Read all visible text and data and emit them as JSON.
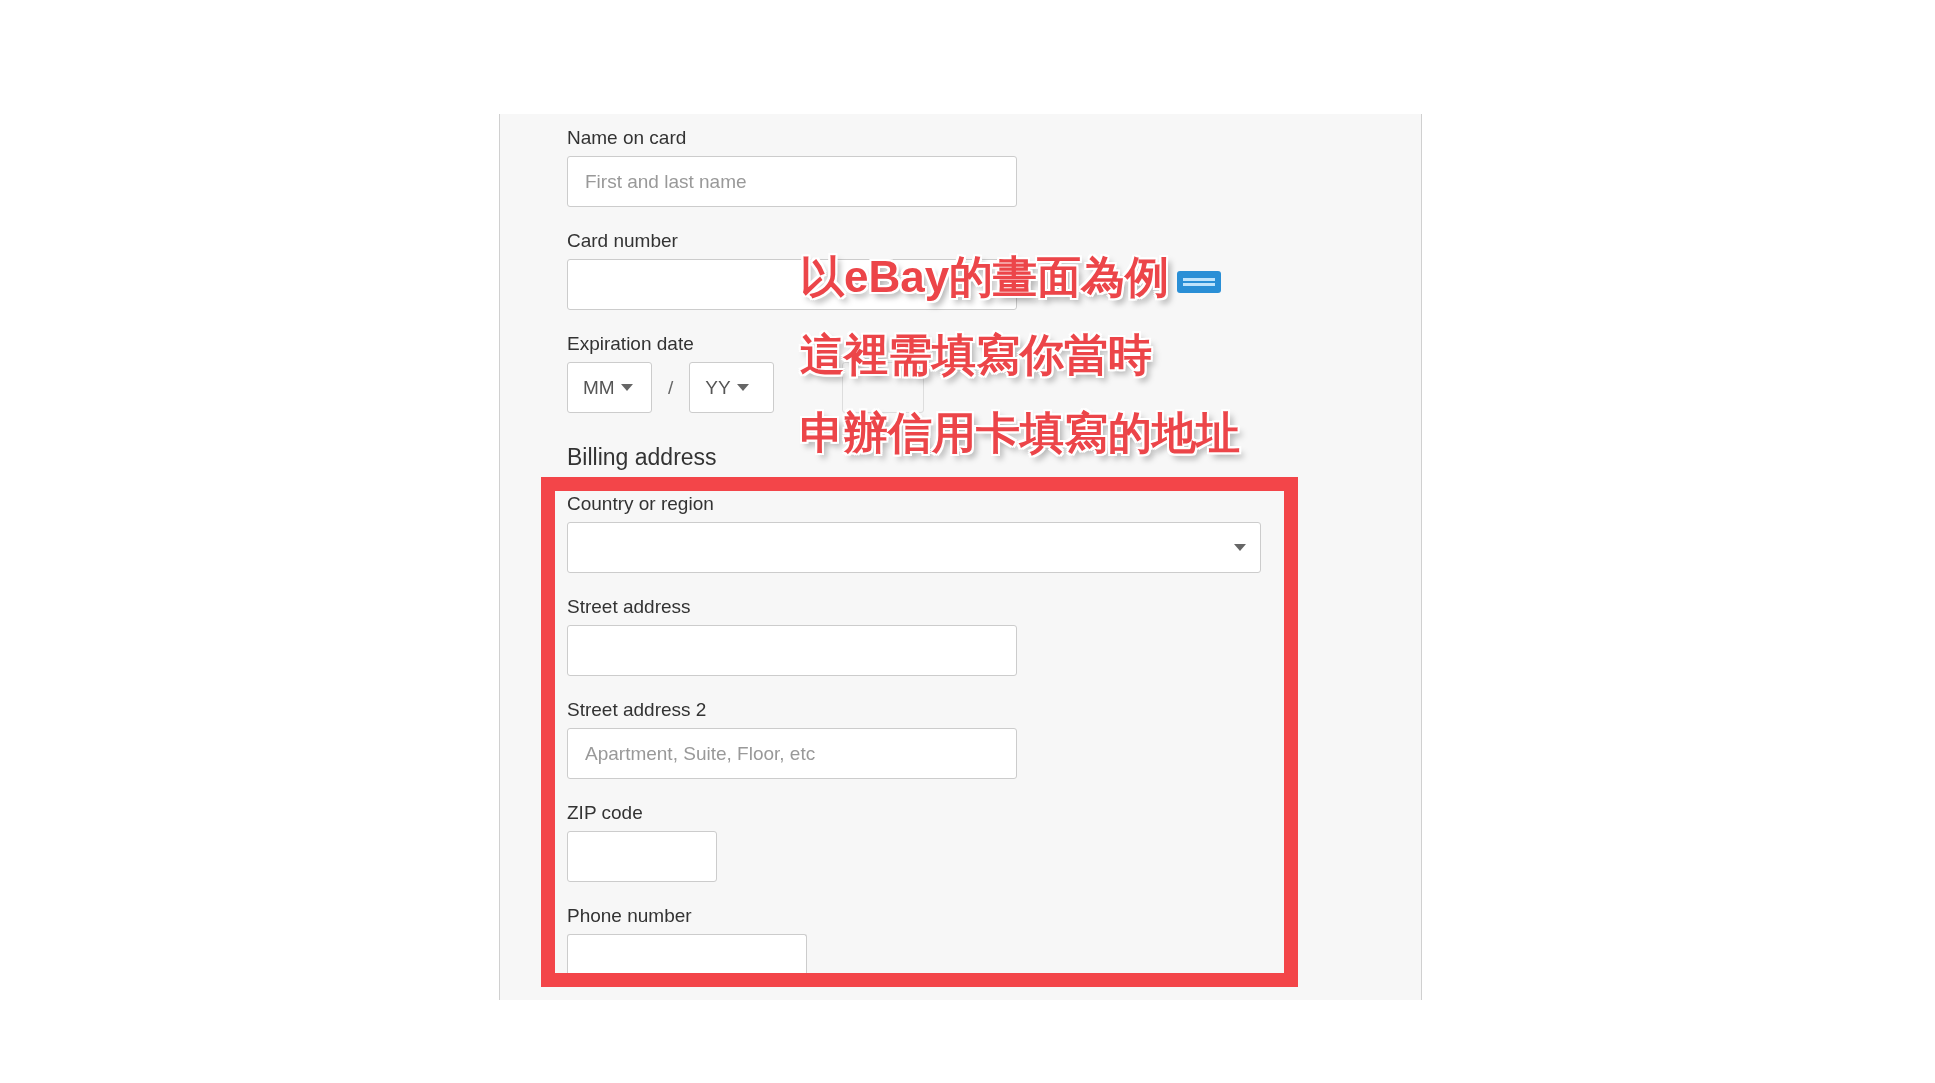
{
  "form": {
    "card_fields": [
      {
        "kind": "text",
        "label": "Name on card",
        "placeholder": "First and last name"
      },
      {
        "kind": "text",
        "label": "Card number"
      }
    ],
    "expiration": {
      "label": "Expiration date",
      "month": "MM",
      "separator": "/",
      "year": "YY"
    },
    "billing_heading": "Billing address",
    "billing_fields": [
      {
        "kind": "select",
        "label": "Country or region"
      },
      {
        "kind": "text",
        "label": "Street address"
      },
      {
        "kind": "text",
        "label": "Street address 2",
        "placeholder": "Apartment, Suite, Floor, etc"
      },
      {
        "kind": "short",
        "label": "ZIP code"
      },
      {
        "kind": "medium",
        "label": "Phone number"
      }
    ]
  },
  "annotation": {
    "lines": [
      "以eBay的畫面為例",
      "這裡需填寫你當時",
      "申辦信用卡填寫的地址"
    ]
  }
}
